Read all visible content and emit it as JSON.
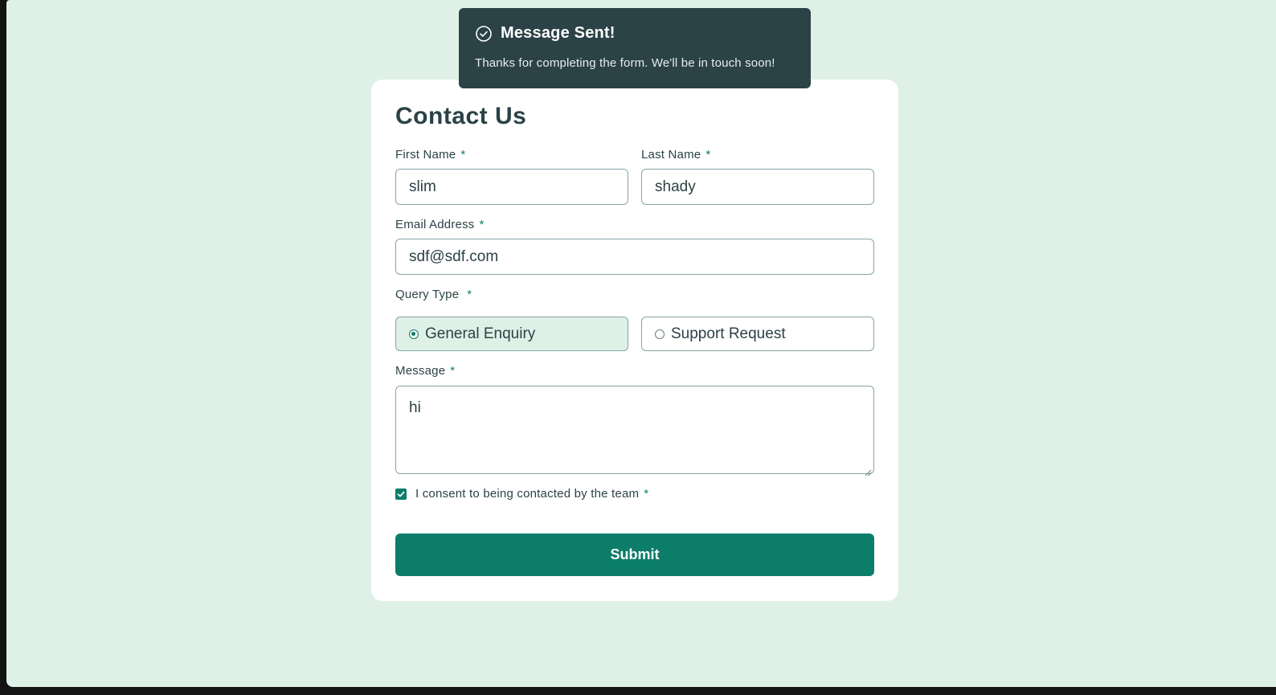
{
  "toast": {
    "title": "Message Sent!",
    "message": "Thanks for completing the form. We'll be in touch soon!",
    "icon": "check-circle-icon"
  },
  "form": {
    "title": "Contact Us",
    "required_marker": "*",
    "first_name": {
      "label": "First Name",
      "value": "slim"
    },
    "last_name": {
      "label": "Last Name",
      "value": "shady"
    },
    "email": {
      "label": "Email Address",
      "value": "sdf@sdf.com"
    },
    "query_type": {
      "label": "Query Type",
      "options": [
        {
          "label": "General Enquiry",
          "selected": true
        },
        {
          "label": "Support Request",
          "selected": false
        }
      ]
    },
    "message": {
      "label": "Message",
      "value": "hi"
    },
    "consent": {
      "label": "I consent to being contacted by the team",
      "checked": true
    },
    "submit_label": "Submit"
  },
  "colors": {
    "page_background": "#dff1e7",
    "toast_background": "#2b4246",
    "accent": "#0c7d69",
    "text": "#2b4246",
    "border": "#87a3a6"
  }
}
